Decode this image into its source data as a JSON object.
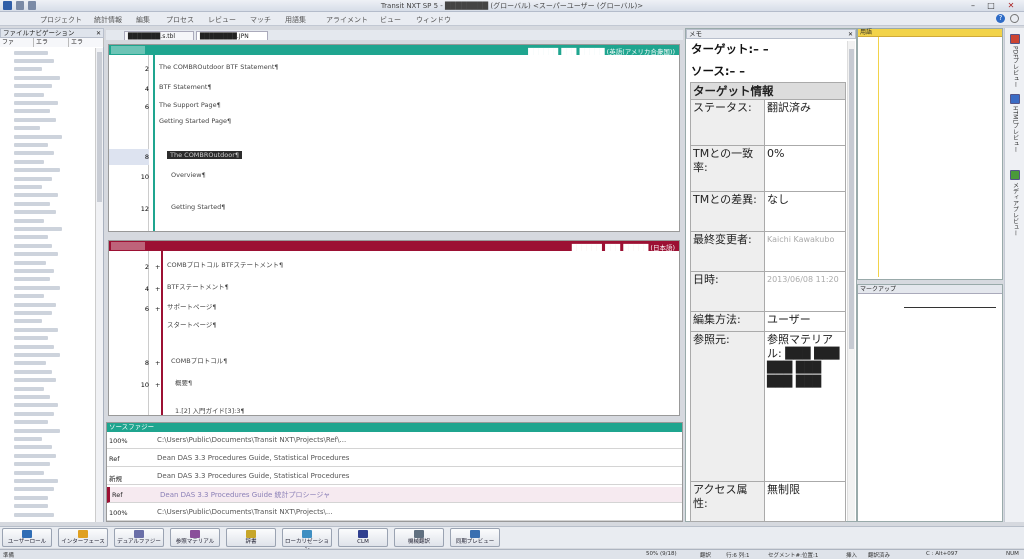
{
  "window": {
    "title": "Transit NXT SP 5 - ████████ (グローバル) <スーパーユーザー (グローバル)>"
  },
  "menu": [
    "プロジェクト",
    "統計情報",
    "編集",
    "プロセス",
    "レビュー",
    "マッチ",
    "用語集",
    "アライメント",
    "ビュー",
    "ウィンドウ"
  ],
  "filenav": {
    "title": "ファイルナビゲーション",
    "tabs": [
      "ファ",
      "エラ",
      "エラ"
    ]
  },
  "doctabs": [
    "███████.s.tbl",
    "████████.JPN"
  ],
  "source_pane": {
    "lang": "██████_███_█████ (英語(アメリカ合衆国))",
    "rows": [
      {
        "n": "2",
        "text": "The COMBROutdoor BTF Statement¶"
      },
      {
        "n": "4",
        "text": "BTF Statement¶"
      },
      {
        "n": "6",
        "text": "The Support Page¶"
      },
      {
        "n": "",
        "text": "Getting Started Page¶"
      },
      {
        "n": "8",
        "text": "The COMBROutdoor¶"
      },
      {
        "n": "10",
        "text": "Overview¶"
      },
      {
        "n": "12",
        "text": "Getting Started¶"
      }
    ]
  },
  "target_pane": {
    "lang": "██████_███_█████ (日本語)",
    "rows": [
      {
        "n": "2",
        "plus": "+",
        "text": "COMBプロトコル BTFステートメント¶"
      },
      {
        "n": "4",
        "plus": "+",
        "text": "BTFステートメント¶"
      },
      {
        "n": "6",
        "plus": "+",
        "text": "サポートページ¶"
      },
      {
        "n": "",
        "plus": "",
        "text": "スタートページ¶"
      },
      {
        "n": "8",
        "plus": "+",
        "text": "COMBプロトコル¶"
      },
      {
        "n": "10",
        "plus": "+",
        "text": "概要¶"
      },
      {
        "n": "",
        "plus": "",
        "text": "1.[2] 入門ガイド[3]:3¶"
      }
    ]
  },
  "fuzzy": {
    "title": "ソースファジー",
    "rows": [
      {
        "label": "100%",
        "text": "C:\\Users\\Public\\Documents\\Transit NXT\\Projects\\Ref\\..."
      },
      {
        "label": "Ref",
        "text": "Dean DAS 3.3 Procedures Guide, Statistical Procedures"
      },
      {
        "label": "新規",
        "text": "Dean DAS 3.3 Procedures Guide, Statistical Procedures"
      },
      {
        "label": "Ref",
        "text": "Dean DAS 3.3 Procedures Guide 統計プロシージャ"
      },
      {
        "label": "100%",
        "text": "C:\\Users\\Public\\Documents\\Transit NXT\\Projects\\..."
      }
    ]
  },
  "memo": {
    "title": "メモ",
    "target_label": "ターゲット:",
    "target_value": "– –",
    "source_label": "ソース:",
    "source_value": "– –",
    "info_header": "ターゲット情報",
    "rows": [
      {
        "k": "ステータス:",
        "v": "翻訳済み"
      },
      {
        "k": "TMとの一致率:",
        "v": "0%"
      },
      {
        "k": "TMとの差異:",
        "v": "なし"
      },
      {
        "k": "最終変更者:",
        "v": "Kaichi Kawakubo"
      },
      {
        "k": "日時:",
        "v": "2013/06/08 11:20"
      },
      {
        "k": "編集方法:",
        "v": "ユーザー"
      },
      {
        "k": "参照元:",
        "v": "参照マテリアル: ███ ███ ███ ███ ███ ███"
      },
      {
        "k": "アクセス属性:",
        "v": "無制限"
      }
    ]
  },
  "glossary": {
    "title": "用語"
  },
  "markup": {
    "title": "マークアップ"
  },
  "rightbar": [
    "PDFプレビュー",
    "HTMLプレビュー",
    "メディアプレビュー"
  ],
  "bottom_buttons": [
    "ユーザーロール",
    "インターフェース",
    "デュアルファジー",
    "参照マテリアル",
    "辞書",
    "ローカリゼーション",
    "CLM",
    "機械翻訳",
    "同期プレビュー"
  ],
  "status": {
    "ready": "準備",
    "progress": "50% (9/18)",
    "state": "翻訳",
    "position": "行:6 列:1",
    "segment": "セグメント#:位置:1",
    "insert": "挿入",
    "translated": "翻訳済み",
    "shortcut": "C : Alt+097",
    "num": "NUM"
  },
  "colors": {
    "source_head": "#1fa58f",
    "target_head": "#9c1033",
    "glossary_head": "#f2d34a"
  }
}
